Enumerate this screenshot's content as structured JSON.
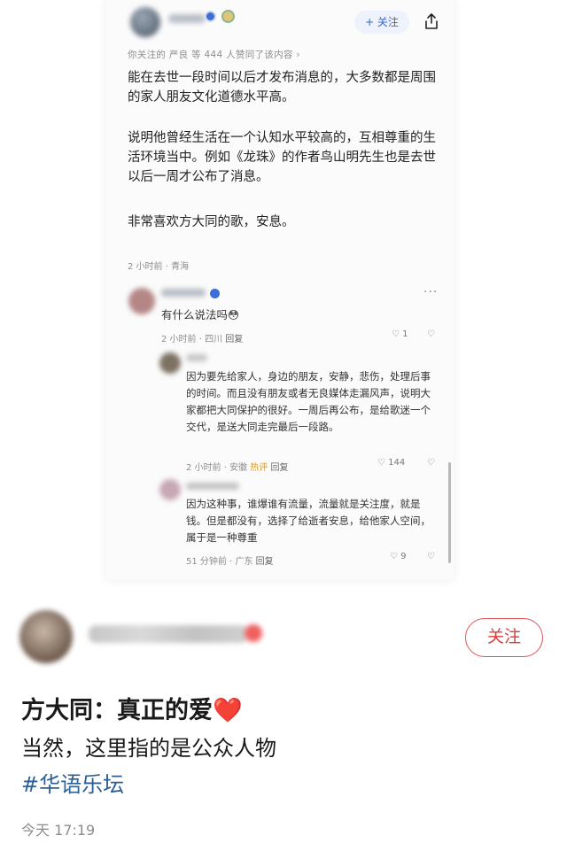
{
  "card": {
    "follow_label": "+ 关注",
    "liked_line": "你关注的 严良 等 444 人赞同了该内容 ›",
    "answer_paragraphs": [
      "能在去世一段时间以后才发布消息的，大多数都是周围的家人朋友文化道德水平高。",
      "说明他曾经生活在一个认知水平较高的，互相尊重的生活环境当中。例如《龙珠》的作者鸟山明先生也是去世以后一周才公布了消息。",
      "非常喜欢方大同的歌，安息。"
    ],
    "answer_meta": "2 小时前 · 青海",
    "comments": [
      {
        "text": "有什么说法吗😳",
        "meta_time": "2 小时前 · 四川",
        "reply_label": "回复",
        "likes": "1"
      },
      {
        "text": "因为要先给家人，身边的朋友，安静，悲伤，处理后事的时间。而且没有朋友或者无良媒体走漏风声，说明大家都把大同保护的很好。一周后再公布，是给歌迷一个交代，是送大同走完最后一段路。",
        "meta_time": "2 小时前 · 安徽",
        "hot_label": "热评",
        "reply_label": "回复",
        "likes": "144"
      },
      {
        "text": "因为这种事，谁爆谁有流量，流量就是关注度，就是钱。但是都没有，选择了给逝者安息，给他家人空间，属于是一种尊重",
        "meta_time": "51 分钟前 · 广东",
        "reply_label": "回复",
        "likes": "9"
      }
    ]
  },
  "post": {
    "follow_label": "关注",
    "title": "方大同：真正的爱❤️",
    "subtitle": "当然，这里指的是公众人物",
    "hashtag": "#华语乐坛",
    "time": "今天 17:19"
  },
  "colors": {
    "accent_red": "#d83d3d",
    "link_blue": "#2b5f96",
    "follow_blue": "#3767d6",
    "hot": "#d19a2a"
  }
}
